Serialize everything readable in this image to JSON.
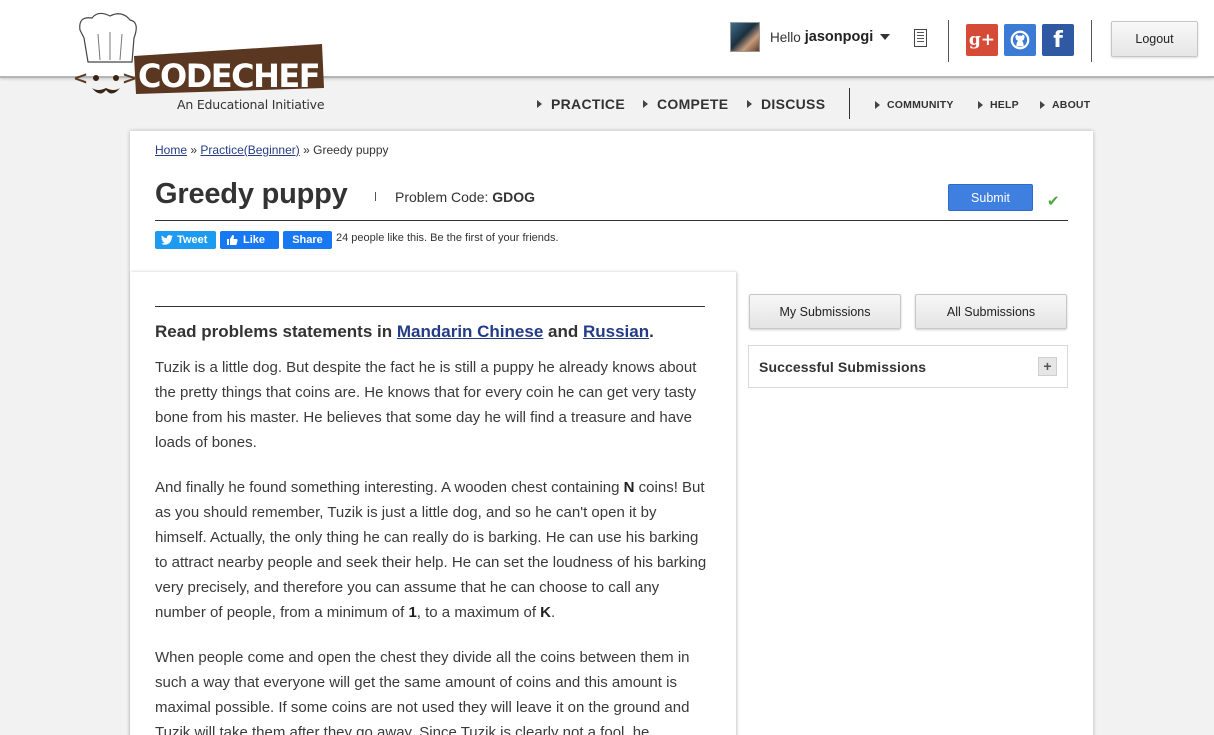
{
  "header": {
    "logo_text": "CODECHEF",
    "logo_tagline": "An Educational Initiative",
    "greeting": "Hello",
    "username": "jasonpogi",
    "logout_label": "Logout",
    "social": {
      "google_plus": "g+",
      "facebook": "f"
    }
  },
  "nav": {
    "main": [
      "PRACTICE",
      "COMPETE",
      "DISCUSS"
    ],
    "secondary": [
      "COMMUNITY",
      "HELP",
      "ABOUT"
    ]
  },
  "breadcrumb": {
    "home": "Home",
    "practice": "Practice(Beginner)",
    "current": "Greedy puppy",
    "separator": "»"
  },
  "problem": {
    "title": "Greedy puppy",
    "code_label": "Problem Code:",
    "code": "GDOG",
    "submit_label": "Submit"
  },
  "share": {
    "tweet": "Tweet",
    "like": "Like",
    "share": "Share",
    "likes_text": "24 people like this. Be the first of your friends."
  },
  "statement": {
    "read_prefix": "Read problems statements in",
    "lang1": "Mandarin Chinese",
    "and": "and",
    "lang2": "Russian",
    "p1": "Tuzik is a little dog. But despite the fact he is still a puppy he already knows about the pretty things that coins are. He knows that for every coin he can get very tasty bone from his master. He believes that some day he will find a treasure and have loads of bones.",
    "p2a": "And finally he found something interesting. A wooden chest containing",
    "p2N": "N",
    "p2b": "coins! But as you should remember, Tuzik is just a little dog, and so he can't open it by himself. Actually, the only thing he can really do is barking. He can use his barking to attract nearby people and seek their help. He can set the loudness of his barking very precisely, and therefore you can assume that he can choose to call any number of people, from a minimum of",
    "p2one": "1",
    "p2c": ", to a maximum of",
    "p2K": "K",
    "p2d": ".",
    "p3": "When people come and open the chest they divide all the coins between them in such a way that everyone will get the same amount of coins and this amount is maximal possible. If some coins are not used they will leave it on the ground and Tuzik will take them after they go away. Since Tuzik is clearly not a fool, he"
  },
  "sidebar": {
    "my_submissions": "My Submissions",
    "all_submissions": "All Submissions",
    "successful_submissions": "Successful Submissions",
    "expand": "+"
  }
}
